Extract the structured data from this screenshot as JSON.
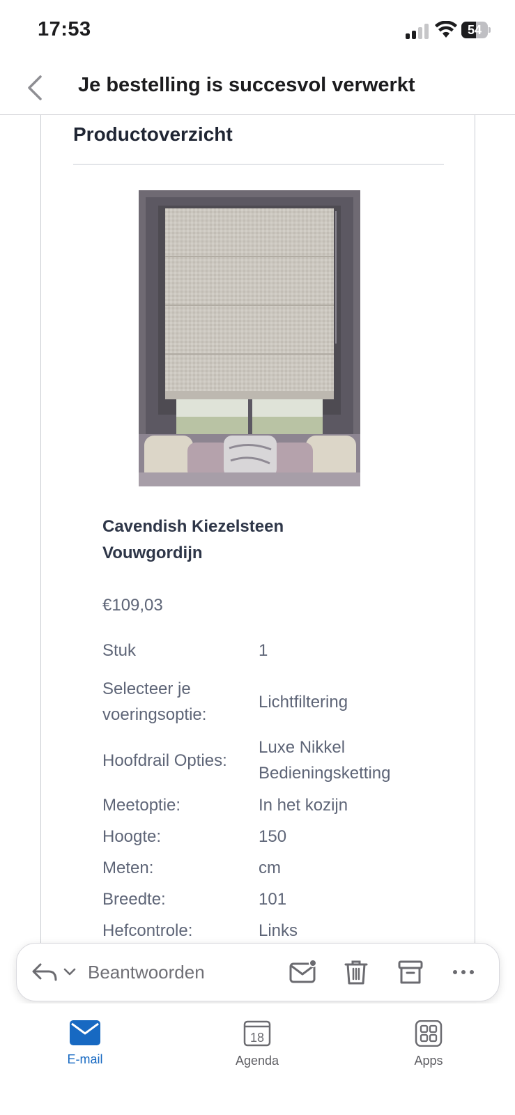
{
  "status_bar": {
    "time": "17:53",
    "battery": "54"
  },
  "nav": {
    "title": "Je bestelling is succesvol verwerkt"
  },
  "email": {
    "heading": "Productoverzicht",
    "product": {
      "name": "Cavendish Kiezelsteen Vouwgordijn",
      "price": "€109,03",
      "specs": [
        {
          "label": "Stuk",
          "value": "1"
        },
        {
          "label": "Selecteer je voeringsoptie:",
          "value": "Lichtfiltering"
        },
        {
          "label": "Hoofdrail Opties:",
          "value": "Luxe Nikkel Bedieningsketting"
        },
        {
          "label": "Meetoptie:",
          "value": "In het kozijn"
        },
        {
          "label": "Hoogte:",
          "value": "150"
        },
        {
          "label": "Meten:",
          "value": "cm"
        },
        {
          "label": "Breedte:",
          "value": "101"
        },
        {
          "label": "Hefcontrole:",
          "value": "Links"
        }
      ]
    }
  },
  "reply_bar": {
    "reply_label": "Beantwoorden",
    "icons": [
      "reply-icon",
      "chevron-down-icon",
      "mail-unread-icon",
      "trash-icon",
      "archive-icon",
      "more-icon"
    ]
  },
  "tab_bar": {
    "tabs": [
      {
        "label": "E-mail",
        "active": true
      },
      {
        "label": "Agenda",
        "active": false,
        "day": "18"
      },
      {
        "label": "Apps",
        "active": false
      }
    ]
  },
  "colors": {
    "accent": "#1769c2",
    "text_dark": "#1f2533",
    "text_muted": "#5e6577"
  }
}
